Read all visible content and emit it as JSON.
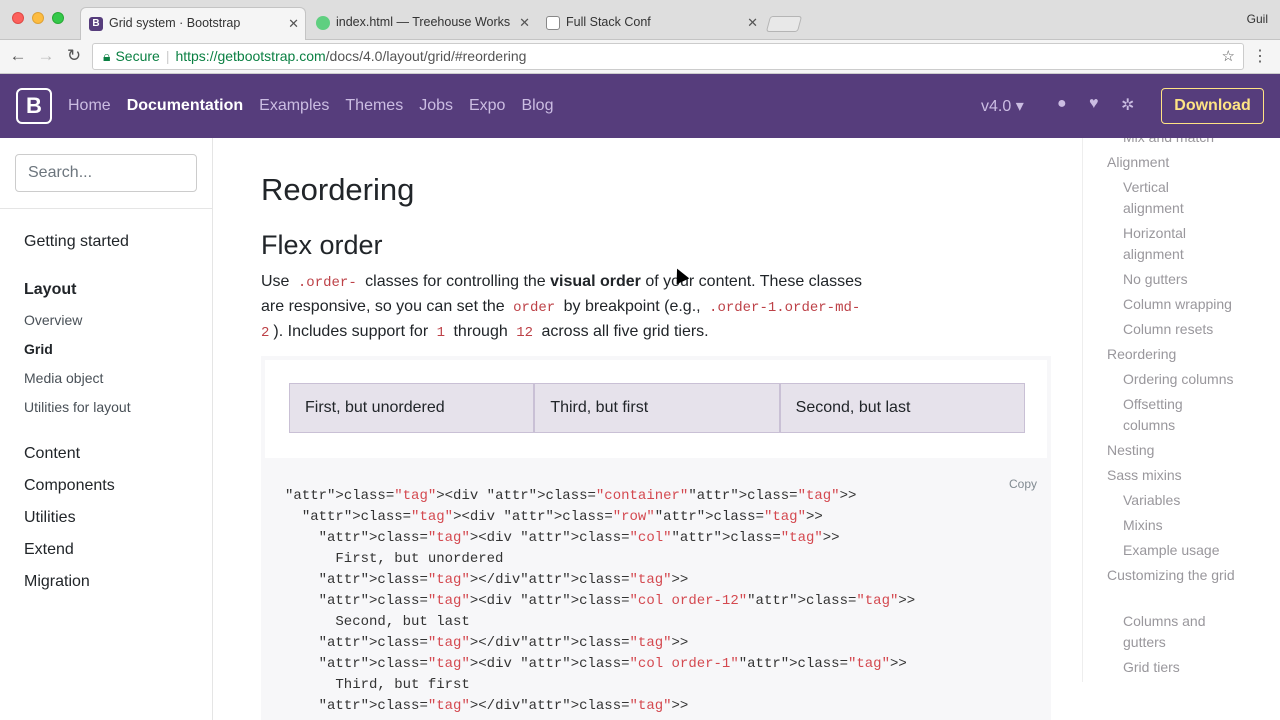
{
  "browser": {
    "tabs": [
      {
        "title": "Grid system · Bootstrap",
        "favicon": "B"
      },
      {
        "title": "index.html — Treehouse Works"
      },
      {
        "title": "Full Stack Conf"
      }
    ],
    "user": "Guil",
    "secure_label": "Secure",
    "url_host": "https://getbootstrap.com",
    "url_path": "/docs/4.0/layout/grid/#reordering"
  },
  "navbar": {
    "brand": "B",
    "links": [
      "Home",
      "Documentation",
      "Examples",
      "Themes",
      "Jobs",
      "Expo",
      "Blog"
    ],
    "version": "v4.0 ▾",
    "download": "Download"
  },
  "sidebar": {
    "search_placeholder": "Search...",
    "items": [
      "Getting started",
      "Layout",
      "Overview",
      "Grid",
      "Media object",
      "Utilities for layout",
      "Content",
      "Components",
      "Utilities",
      "Extend",
      "Migration"
    ]
  },
  "main": {
    "title": "Reordering",
    "subtitle": "Flex order",
    "p1": "Use",
    "code1": ".order-",
    "p2": "classes for controlling the",
    "strong": "visual order",
    "p3": "of your content. These classes are responsive, so you can set the",
    "code2": "order",
    "p4": "by breakpoint (e.g.,",
    "code3": ".order-1.order-md-2",
    "p5": "). Includes support for",
    "code4": "1",
    "p6": "through",
    "code5": "12",
    "p7": "across all five grid tiers.",
    "cols": [
      "First, but unordered",
      "Third, but first",
      "Second, but last"
    ],
    "copy": "Copy",
    "code_lines": [
      "<div class=\"container\">",
      "  <div class=\"row\">",
      "    <div class=\"col\">",
      "      First, but unordered",
      "    </div>",
      "    <div class=\"col order-12\">",
      "      Second, but last",
      "    </div>",
      "    <div class=\"col order-1\">",
      "      Third, but first",
      "    </div>"
    ]
  },
  "toc": [
    "Mix and match",
    "Alignment",
    "Vertical alignment",
    "Horizontal alignment",
    "No gutters",
    "Column wrapping",
    "Column resets",
    "Reordering",
    "Ordering columns",
    "Offsetting columns",
    "Nesting",
    "Sass mixins",
    "Variables",
    "Mixins",
    "Example usage",
    "Customizing the grid",
    "Columns and gutters",
    "Grid tiers"
  ]
}
